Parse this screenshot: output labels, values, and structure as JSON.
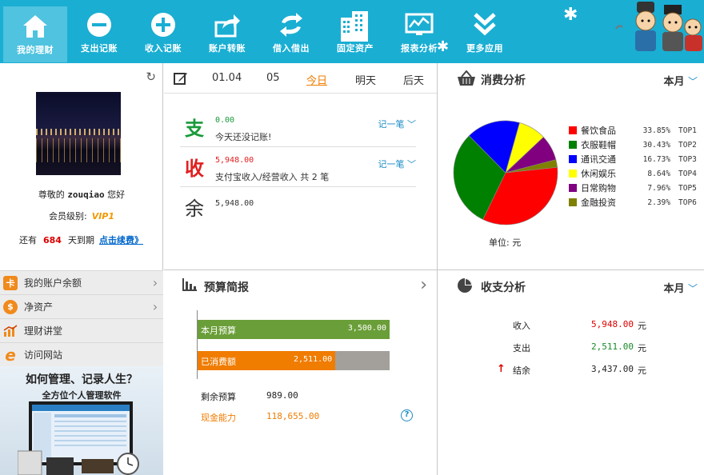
{
  "toolbar": {
    "items": [
      {
        "label": "我的理财",
        "icon": "home-icon"
      },
      {
        "label": "支出记账",
        "icon": "minus-circle-icon"
      },
      {
        "label": "收入记账",
        "icon": "plus-circle-icon"
      },
      {
        "label": "账户转账",
        "icon": "share-arrow-icon"
      },
      {
        "label": "借入借出",
        "icon": "exchange-icon"
      },
      {
        "label": "固定资产",
        "icon": "building-icon"
      },
      {
        "label": "报表分析",
        "icon": "chart-monitor-icon"
      },
      {
        "label": "更多应用",
        "icon": "double-chevron-icon"
      }
    ],
    "accent": "#1aaed3"
  },
  "profile": {
    "greeting_prefix": "尊敬的",
    "username": "zouqiao",
    "greeting_suffix": "您好",
    "level_label": "会员级别:",
    "level_value": "VIP1",
    "expire_prefix": "还有",
    "expire_days": "684",
    "expire_suffix": "天到期",
    "renew_link": "点击续费》"
  },
  "sidebar": {
    "items": [
      {
        "label": "我的账户余额",
        "chevron": "›"
      },
      {
        "label": "净资产",
        "chevron": "›"
      },
      {
        "label": "理财讲堂"
      },
      {
        "label": "访问网站"
      }
    ]
  },
  "ad": {
    "title": "如何管理、记录人生？",
    "subtitle": "全方位个人管理软件"
  },
  "daily": {
    "dates": [
      "01.04",
      "05",
      "今日",
      "明天",
      "后天"
    ],
    "expense": {
      "glyph": "支",
      "amount": "0.00",
      "desc": "今天还没记账!",
      "action": "记一笔"
    },
    "income": {
      "glyph": "收",
      "amount": "5,948.00",
      "desc": "支付宝收入/经营收入 共 2 笔",
      "action": "记一笔"
    },
    "balance": {
      "glyph": "余",
      "amount": "5,948.00"
    }
  },
  "consumption": {
    "title": "消费分析",
    "period": "本月",
    "unit": "单位: 元"
  },
  "chart_data": {
    "type": "pie",
    "title": "消费分析",
    "categories": [
      "餐饮食品",
      "衣服鞋帽",
      "通讯交通",
      "休闲娱乐",
      "日常购物",
      "金融投资"
    ],
    "values": [
      33.85,
      30.43,
      16.73,
      8.64,
      7.96,
      2.39
    ],
    "labels": [
      "33.85%",
      "30.43%",
      "16.73%",
      "8.64%",
      "7.96%",
      "2.39%"
    ],
    "ranks": [
      "TOP1",
      "TOP2",
      "TOP3",
      "TOP4",
      "TOP5",
      "TOP6"
    ],
    "colors": [
      "#ff0000",
      "#008000",
      "#0000ff",
      "#ffff00",
      "#800080",
      "#808000"
    ],
    "legend": "right"
  },
  "budget": {
    "title": "预算简报",
    "budget_label": "本月预算",
    "budget_value": "3,500.00",
    "spent_label": "已消费额",
    "spent_value": "2,511.00",
    "spent_fraction": 0.7174,
    "remaining_label": "剩余预算",
    "remaining_value": "989.00",
    "cash_label": "现金能力",
    "cash_value": "118,655.00"
  },
  "summary": {
    "title": "收支分析",
    "period": "本月",
    "income_label": "收入",
    "income_value": "5,948.00",
    "expense_label": "支出",
    "expense_value": "2,511.00",
    "balance_label": "结余",
    "balance_value": "3,437.00",
    "unit": "元"
  }
}
